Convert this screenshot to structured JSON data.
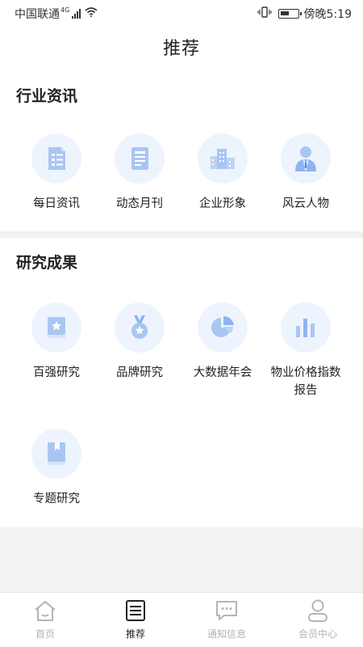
{
  "status_bar": {
    "carrier": "中国联通",
    "network": "4G",
    "time": "傍晚5:19",
    "battery_level": 0.55
  },
  "header": {
    "title": "推荐"
  },
  "industry": {
    "title": "行业资讯",
    "items": [
      {
        "label": "每日资讯",
        "icon": "news-doc-icon"
      },
      {
        "label": "动态月刊",
        "icon": "monthly-doc-icon"
      },
      {
        "label": "企业形象",
        "icon": "buildings-icon"
      },
      {
        "label": "风云人物",
        "icon": "person-icon"
      }
    ]
  },
  "research": {
    "title": "研究成果",
    "items": [
      {
        "label": "百强研究",
        "icon": "star-book-icon"
      },
      {
        "label": "品牌研究",
        "icon": "medal-icon"
      },
      {
        "label": "大数据年会",
        "icon": "pie-chart-icon"
      },
      {
        "label": "物业价格指数报告",
        "icon": "bar-chart-icon"
      },
      {
        "label": "专题研究",
        "icon": "bookmark-book-icon"
      }
    ]
  },
  "tabbar": {
    "tabs": [
      {
        "label": "首页",
        "icon": "home-icon"
      },
      {
        "label": "推荐",
        "icon": "list-doc-icon",
        "active": true
      },
      {
        "label": "通知信息",
        "icon": "message-icon"
      },
      {
        "label": "会员中心",
        "icon": "user-icon"
      }
    ]
  },
  "colors": {
    "accent": "#4f86e8",
    "icon_light": "#a9c6f3",
    "icon_bg": "#eef4fd",
    "tab_inactive": "#b4b4b4"
  }
}
